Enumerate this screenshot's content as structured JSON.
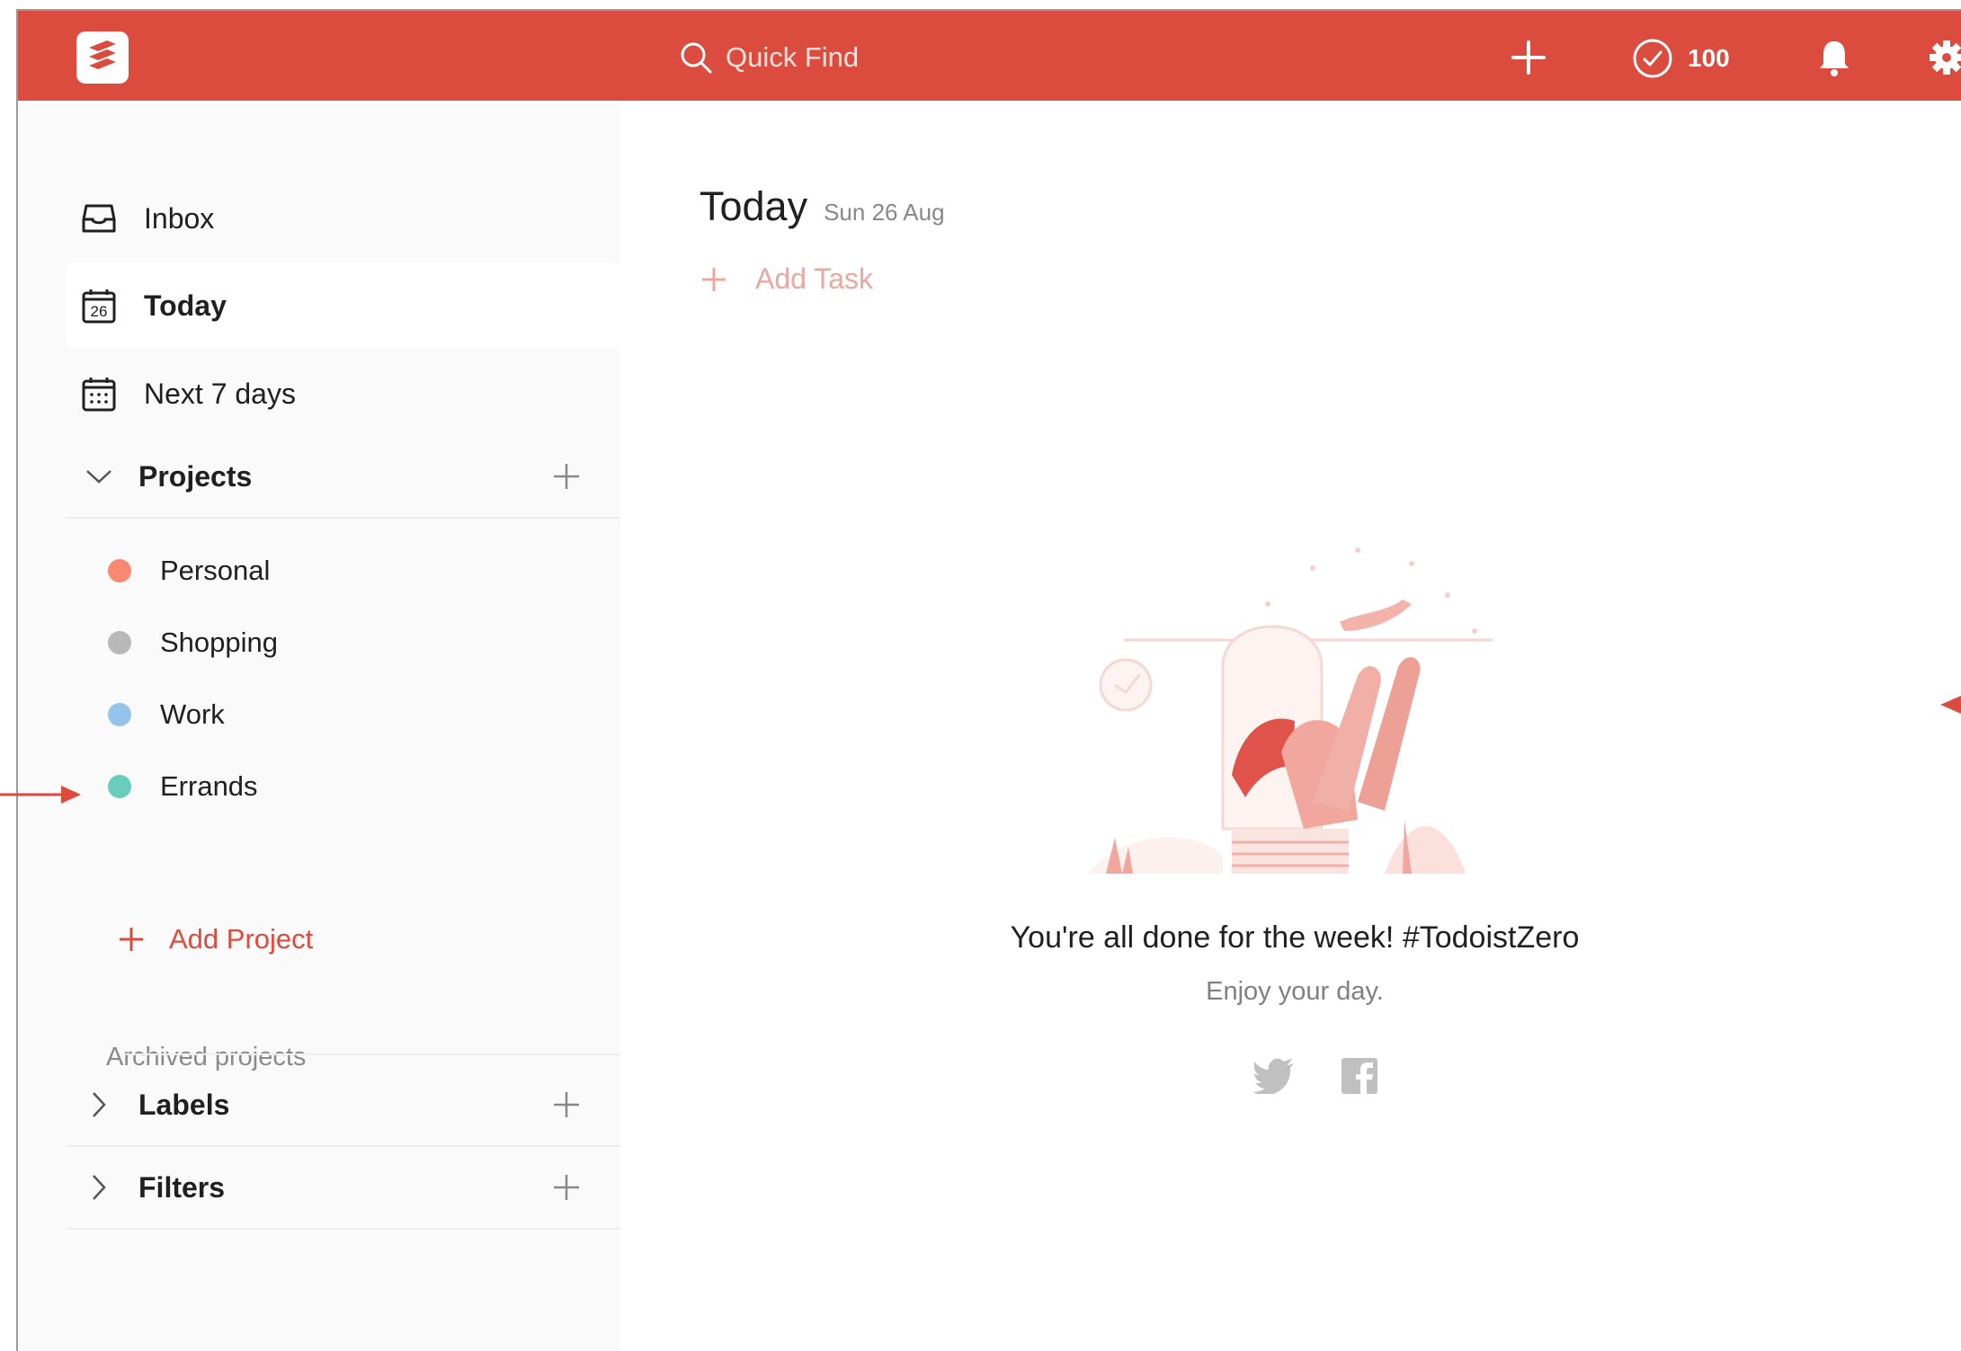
{
  "colors": {
    "brand": "#db4c3f",
    "sidebar_bg": "#fafafa",
    "project_personal": "#fa8872",
    "project_shopping": "#b8b8b8",
    "project_work": "#96c3eb",
    "project_errands": "#6accbc"
  },
  "topbar": {
    "search_placeholder": "Quick Find",
    "karma_count": "100",
    "icons": [
      "todoist-logo-icon",
      "search-icon",
      "plus-icon",
      "checkmark-circle-icon",
      "bell-icon",
      "gear-icon"
    ]
  },
  "sidebar": {
    "items": [
      {
        "label": "Inbox",
        "icon": "inbox-icon"
      },
      {
        "label": "Today",
        "icon": "calendar-today-icon",
        "icon_text": "26"
      },
      {
        "label": "Next 7 days",
        "icon": "calendar-week-icon"
      }
    ],
    "projects_header": "Projects",
    "projects": [
      {
        "label": "Personal",
        "color": "#fa8872"
      },
      {
        "label": "Shopping",
        "color": "#b8b8b8"
      },
      {
        "label": "Work",
        "color": "#96c3eb"
      },
      {
        "label": "Errands",
        "color": "#6accbc"
      }
    ],
    "add_project": "Add Project",
    "archived": "Archived projects",
    "labels_header": "Labels",
    "filters_header": "Filters"
  },
  "main": {
    "title": "Today",
    "date": "Sun 26 Aug",
    "add_task": "Add Task",
    "empty_title": "You're all done for the week! #TodoistZero",
    "empty_subtitle": "Enjoy your day."
  }
}
